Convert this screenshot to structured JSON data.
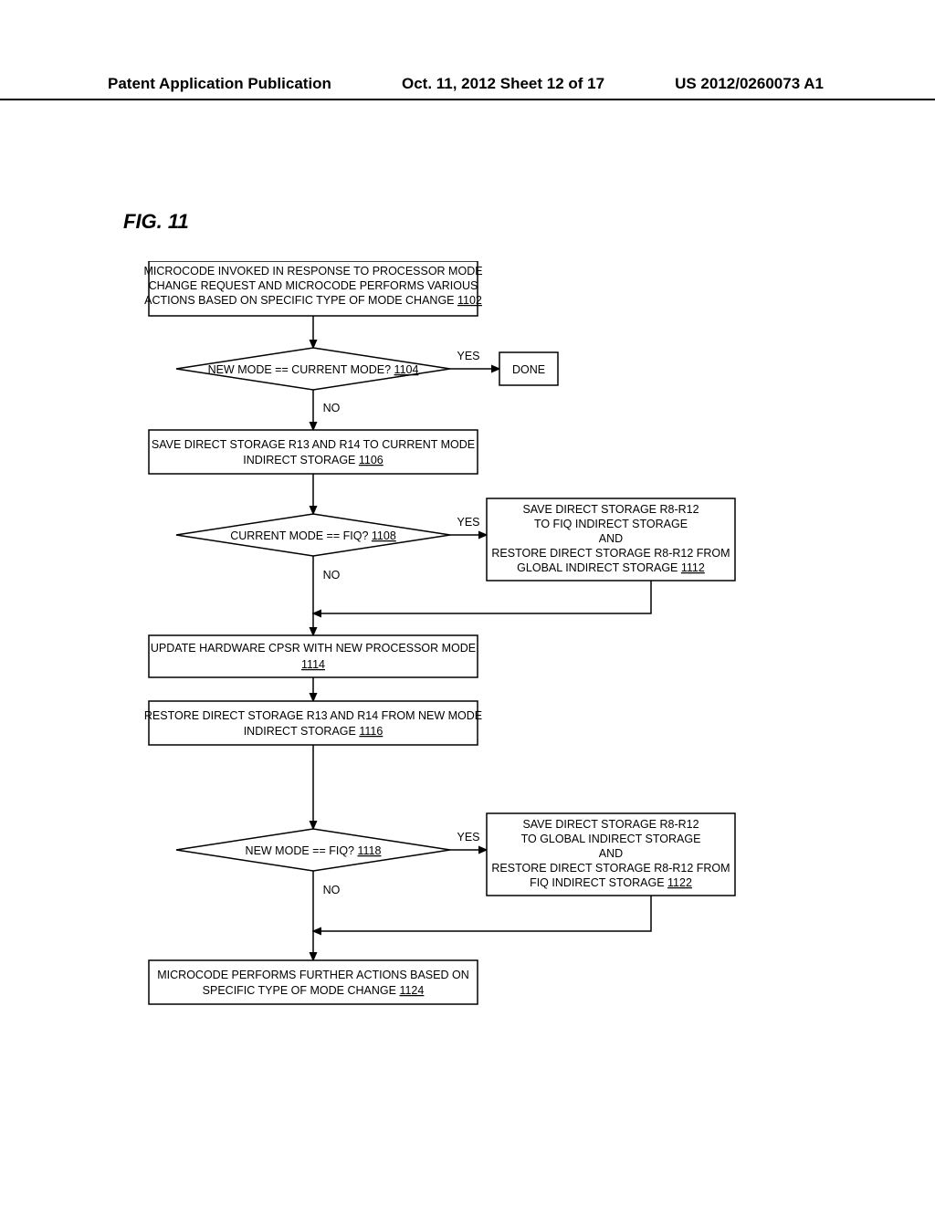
{
  "header": {
    "left": "Patent Application Publication",
    "center": "Oct. 11, 2012  Sheet 12 of 17",
    "right": "US 2012/0260073 A1"
  },
  "figure_title": "FIG. 11",
  "boxes": {
    "b1102": {
      "l1": "MICROCODE INVOKED IN RESPONSE TO PROCESSOR MODE",
      "l2": "CHANGE REQUEST AND MICROCODE PERFORMS VARIOUS",
      "l3": "ACTIONS BASED ON SPECIFIC TYPE OF MODE CHANGE",
      "ref": "1102"
    },
    "b1104": {
      "text": "NEW MODE == CURRENT MODE?",
      "ref": "1104"
    },
    "done": {
      "text": "DONE"
    },
    "b1106": {
      "l1": "SAVE DIRECT STORAGE R13 AND R14 TO CURRENT MODE",
      "l2": "INDIRECT STORAGE",
      "ref": "1106"
    },
    "b1108": {
      "text": "CURRENT MODE == FIQ?",
      "ref": "1108"
    },
    "b1112": {
      "l1": "SAVE DIRECT STORAGE R8-R12",
      "l2": "TO FIQ INDIRECT STORAGE",
      "l3": "AND",
      "l4": "RESTORE DIRECT STORAGE R8-R12 FROM",
      "l5": "GLOBAL INDIRECT STORAGE",
      "ref": "1112"
    },
    "b1114": {
      "l1": "UPDATE HARDWARE CPSR WITH NEW PROCESSOR MODE",
      "ref": "1114"
    },
    "b1116": {
      "l1": "RESTORE DIRECT STORAGE R13 AND R14 FROM NEW MODE",
      "l2": "INDIRECT STORAGE",
      "ref": "1116"
    },
    "b1118": {
      "text": "NEW MODE == FIQ?",
      "ref": "1118"
    },
    "b1122": {
      "l1": "SAVE DIRECT STORAGE R8-R12",
      "l2": "TO GLOBAL INDIRECT STORAGE",
      "l3": "AND",
      "l4": "RESTORE DIRECT STORAGE R8-R12 FROM",
      "l5": "FIQ INDIRECT STORAGE",
      "ref": "1122"
    },
    "b1124": {
      "l1": "MICROCODE PERFORMS FURTHER ACTIONS BASED ON",
      "l2": "SPECIFIC TYPE OF MODE CHANGE",
      "ref": "1124"
    }
  },
  "labels": {
    "yes": "YES",
    "no": "NO"
  }
}
